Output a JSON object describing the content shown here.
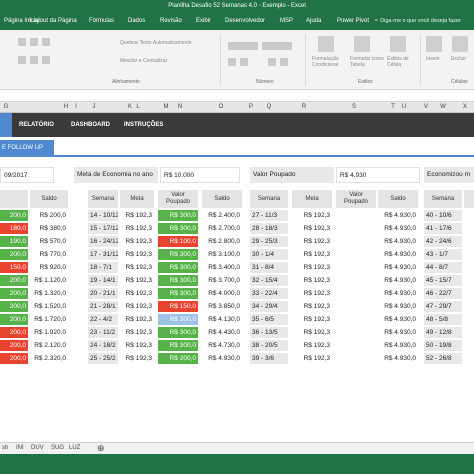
{
  "window": {
    "title": "Planilha Desafio 52 Semanas 4.0 - Exemplo  -  Excel"
  },
  "ribbon_tabs": [
    "Página Inicial",
    "Layout da Página",
    "Fórmulas",
    "Dados",
    "Revisão",
    "Exibir",
    "Desenvolvedor",
    "MSP",
    "Ajuda",
    "Power Pivot"
  ],
  "tell_me": "Diga-me o que você deseja fazer",
  "ribbon": {
    "wrap_text": "Quebrar Texto Automaticamente",
    "merge_center": "Mesclar e Centralizar",
    "format_conditional": "Formatação Condicional",
    "format_table": "Formatar como Tabela",
    "cell_styles": "Estilos de Célula",
    "insert": "Inserir",
    "delete": "Excluir",
    "group_alignment": "Alinhamento",
    "group_number": "Número",
    "group_styles": "Estilos",
    "group_cells": "Células"
  },
  "columns": [
    "G",
    "H",
    "I",
    "J",
    "K",
    "L",
    "M",
    "N",
    "O",
    "P",
    "Q",
    "R",
    "S",
    "T",
    "U",
    "V",
    "W",
    "X"
  ],
  "nav": {
    "relatorio": "RELATÓRIO",
    "dashboard": "DASHBOARD",
    "instrucoes": "INSTRUÇÕES"
  },
  "follow_up": "E FOLLOW UP",
  "info": {
    "date_fragment": "09/2017",
    "meta_label": "Meta de Economia no ano",
    "meta_value": "R$ 10.000",
    "poupado_label": "Valor Poupado",
    "poupado_value": "R$ 4.930",
    "economizou_label": "Economizou m"
  },
  "headers": {
    "saldo": "Saldo",
    "semana": "Semana",
    "meta": "Meta",
    "valor_poupado_1": "Valor",
    "valor_poupado_2": "Poupado"
  },
  "table_left": [
    {
      "v": "200,0",
      "c": "green",
      "s": "R$ 200,0"
    },
    {
      "v": "180,0",
      "c": "red",
      "s": "R$ 380,0"
    },
    {
      "v": "190,0",
      "c": "green",
      "s": "R$ 570,0"
    },
    {
      "v": "200,0",
      "c": "green",
      "s": "R$ 770,0"
    },
    {
      "v": "150,0",
      "c": "red",
      "s": "R$ 920,0"
    },
    {
      "v": "200,0",
      "c": "green",
      "s": "R$ 1.120,0"
    },
    {
      "v": "200,0",
      "c": "green",
      "s": "R$ 1.320,0"
    },
    {
      "v": "200,0",
      "c": "green",
      "s": "R$ 1.520,0"
    },
    {
      "v": "200,0",
      "c": "green",
      "s": "R$ 1.720,0"
    },
    {
      "v": "200,0",
      "c": "red",
      "s": "R$ 1.920,0"
    },
    {
      "v": "200,0",
      "c": "red",
      "s": "R$ 2.120,0"
    },
    {
      "v": "200,0",
      "c": "red",
      "s": "R$ 2.320,0"
    }
  ],
  "table_mid": [
    {
      "semana": "14 - 10/12",
      "meta": "R$ 192,3",
      "v": "R$ 300,0",
      "c": "green",
      "s": "R$ 2.400,0"
    },
    {
      "semana": "15 - 17/12",
      "meta": "R$ 192,3",
      "v": "R$ 300,0",
      "c": "green",
      "s": "R$ 2.700,0"
    },
    {
      "semana": "16 - 24/12",
      "meta": "R$ 192,3",
      "v": "R$ 100,0",
      "c": "red",
      "s": "R$ 2.800,0"
    },
    {
      "semana": "17 - 31/12",
      "meta": "R$ 192,3",
      "v": "R$ 300,0",
      "c": "green",
      "s": "R$ 3.100,0"
    },
    {
      "semana": "18 - 7/1",
      "meta": "R$ 192,3",
      "v": "R$ 300,0",
      "c": "green",
      "s": "R$ 3.400,0"
    },
    {
      "semana": "19 - 14/1",
      "meta": "R$ 192,3",
      "v": "R$ 300,0",
      "c": "green",
      "s": "R$ 3.700,0"
    },
    {
      "semana": "20 - 21/1",
      "meta": "R$ 192,3",
      "v": "R$ 300,0",
      "c": "green",
      "s": "R$ 4.000,0"
    },
    {
      "semana": "21 - 28/1",
      "meta": "R$ 192,3",
      "v": "R$ 150,0",
      "c": "red",
      "s": "R$ 3.850,0"
    },
    {
      "semana": "22 - 4/2",
      "meta": "R$ 192,3",
      "v": "R$ 300,0",
      "c": "lblue",
      "s": "R$ 4.130,0"
    },
    {
      "semana": "23 - 11/2",
      "meta": "R$ 192,3",
      "v": "R$ 300,0",
      "c": "green",
      "s": "R$ 4.430,0"
    },
    {
      "semana": "24 - 18/2",
      "meta": "R$ 192,3",
      "v": "R$ 300,0",
      "c": "green",
      "s": "R$ 4.730,0"
    },
    {
      "semana": "25 - 25/2",
      "meta": "R$ 192,3",
      "v": "R$ 200,0",
      "c": "green",
      "s": "R$ 4.930,0"
    }
  ],
  "table_right": [
    {
      "semana": "27 - 11/3",
      "meta": "R$ 192,3",
      "s": "R$ 4.930,0"
    },
    {
      "semana": "28 - 18/3",
      "meta": "R$ 192,3",
      "s": "R$ 4.930,0"
    },
    {
      "semana": "29 - 25/3",
      "meta": "R$ 192,3",
      "s": "R$ 4.930,0"
    },
    {
      "semana": "30 - 1/4",
      "meta": "R$ 192,3",
      "s": "R$ 4.930,0"
    },
    {
      "semana": "31 - 8/4",
      "meta": "R$ 192,3",
      "s": "R$ 4.930,0"
    },
    {
      "semana": "32 - 15/4",
      "meta": "R$ 192,3",
      "s": "R$ 4.930,0"
    },
    {
      "semana": "33 - 22/4",
      "meta": "R$ 192,3",
      "s": "R$ 4.930,0"
    },
    {
      "semana": "34 - 29/4",
      "meta": "R$ 192,3",
      "s": "R$ 4.930,0"
    },
    {
      "semana": "35 - 6/5",
      "meta": "R$ 192,3",
      "s": "R$ 4.930,0"
    },
    {
      "semana": "36 - 13/5",
      "meta": "R$ 192,3",
      "s": "R$ 4.930,0"
    },
    {
      "semana": "38 - 20/5",
      "meta": "R$ 192,3",
      "s": "R$ 4.930,0"
    },
    {
      "semana": "39 - 3/6",
      "meta": "R$ 192,3",
      "s": "R$ 4.930,0"
    }
  ],
  "table_far": [
    {
      "semana": "40 - 10/6"
    },
    {
      "semana": "41 - 17/6"
    },
    {
      "semana": "42 - 24/6"
    },
    {
      "semana": "43 - 1/7"
    },
    {
      "semana": "44 - 8/7"
    },
    {
      "semana": "45 - 15/7"
    },
    {
      "semana": "46 - 22/7"
    },
    {
      "semana": "47 - 29/7"
    },
    {
      "semana": "48 - 5/8"
    },
    {
      "semana": "49 - 12/8"
    },
    {
      "semana": "50 - 19/8"
    },
    {
      "semana": "52 - 26/8"
    }
  ],
  "sheet_tabs": [
    "sh",
    "INI",
    "DUV",
    "SUG",
    "LUZ"
  ],
  "colors": {
    "excel_green": "#217346",
    "accent_blue": "#4f8ad1",
    "good": "#58b24a",
    "bad": "#e8432f",
    "neutral_blue": "#9cc3e6"
  }
}
